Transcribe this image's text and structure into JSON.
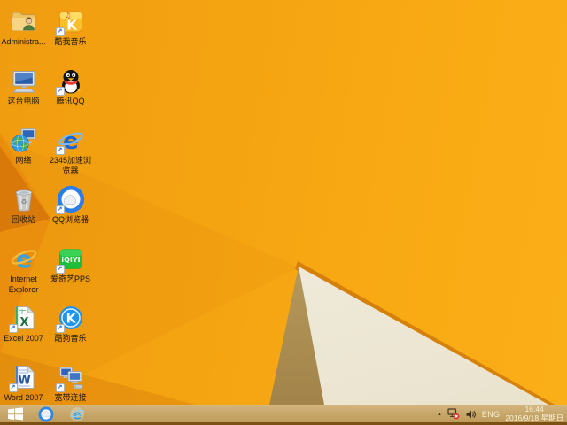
{
  "wallpaper_colors": {
    "base_orange": "#F6A411",
    "facet_mid_orange": "#EA8F0D",
    "facet_dark_orange": "#D9790A",
    "tan_wedge": "#B4955A",
    "cream_wedge": "#F1ECDD",
    "taskbar_tan": "#C6A668"
  },
  "desktop": {
    "columns": [
      {
        "items": [
          {
            "name": "administrator-folder",
            "label": "Administra...",
            "shortcut": false
          },
          {
            "name": "this-pc",
            "label": "这台电脑",
            "shortcut": false
          },
          {
            "name": "network",
            "label": "网络",
            "shortcut": false
          },
          {
            "name": "recycle-bin",
            "label": "回收站",
            "shortcut": false
          },
          {
            "name": "internet-explorer",
            "label": "Internet Explorer",
            "shortcut": false
          },
          {
            "name": "excel-2007",
            "label": "Excel 2007",
            "shortcut": true
          },
          {
            "name": "word-2007",
            "label": "Word 2007",
            "shortcut": true
          }
        ]
      },
      {
        "items": [
          {
            "name": "kuwo-music",
            "label": "酷我音乐",
            "shortcut": true
          },
          {
            "name": "tencent-qq",
            "label": "腾讯QQ",
            "shortcut": true
          },
          {
            "name": "2345-browser",
            "label": "2345加速浏览器",
            "shortcut": true
          },
          {
            "name": "qq-browser",
            "label": "QQ浏览器",
            "shortcut": true
          },
          {
            "name": "iqiyi-pps",
            "label": "爱奇艺PPS",
            "shortcut": true
          },
          {
            "name": "kugou-music",
            "label": "酷狗音乐",
            "shortcut": true
          },
          {
            "name": "broadband-connection",
            "label": "宽带连接",
            "shortcut": true
          }
        ]
      }
    ]
  },
  "taskbar": {
    "pinned": [
      {
        "name": "qq-browser"
      },
      {
        "name": "internet-explorer"
      }
    ],
    "tray": {
      "hidden_icons": "▲",
      "icons": [
        {
          "name": "network-disconnected-icon"
        },
        {
          "name": "volume-icon"
        }
      ],
      "language_indicator": "ENG",
      "time": "16:44",
      "date": "2016/9/18 星期日"
    }
  },
  "icon_glyphs": {
    "shortcut_arrow": "↗",
    "music_notes": "♫",
    "kuwo_k": "K",
    "ie_e": "e",
    "e_2345": "e",
    "recycle_symbol": "♻",
    "iqiyi": "iQIYI",
    "excel_x": "X",
    "kugou_k": "K",
    "word_w": "W"
  }
}
